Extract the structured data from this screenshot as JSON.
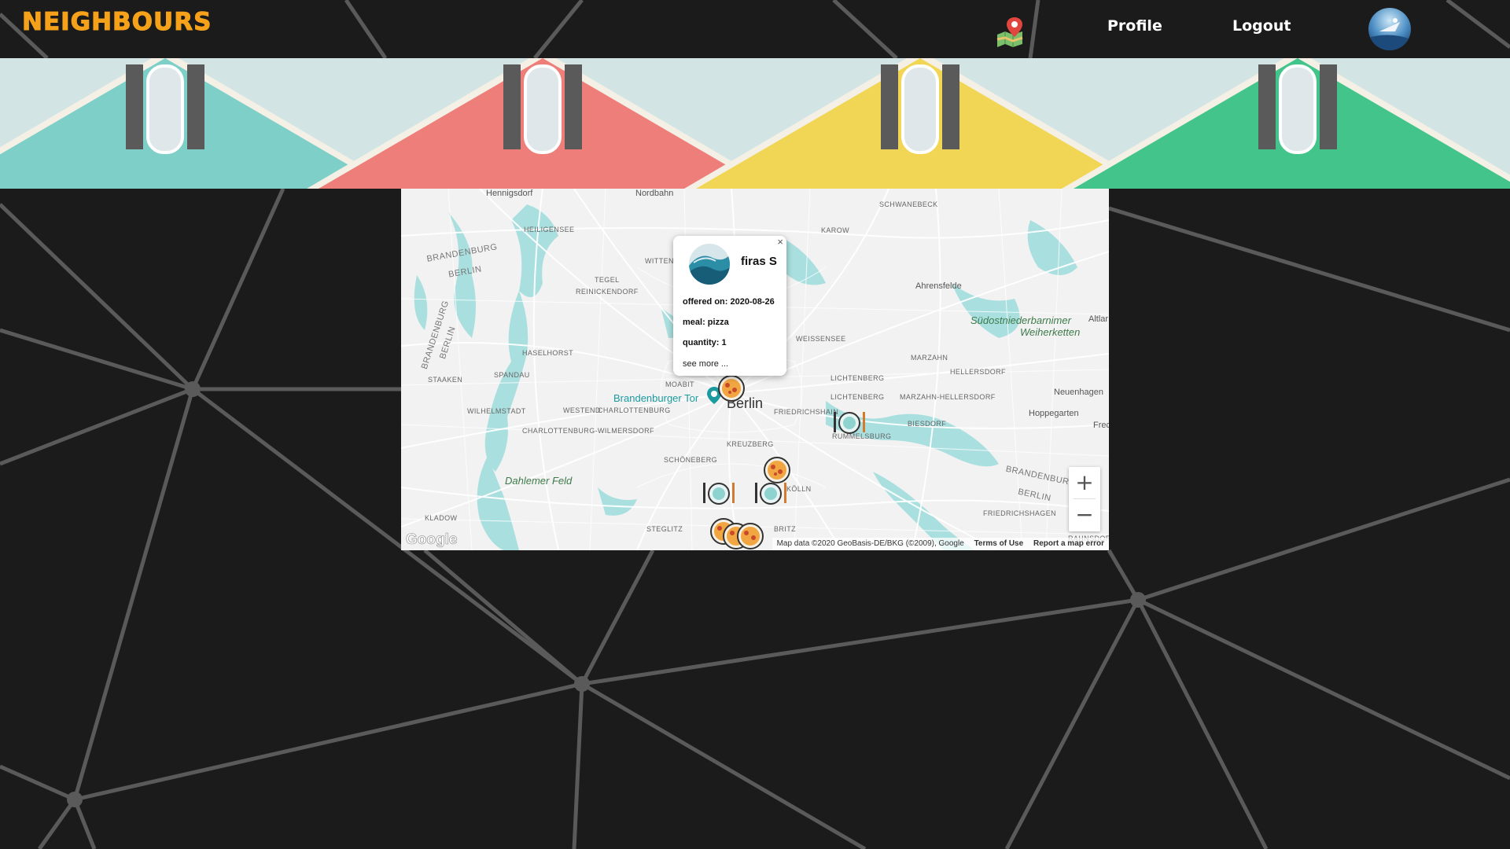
{
  "header": {
    "logo_text": "NEIGHBOURS",
    "map_icon": "map-pin-icon",
    "nav": {
      "profile": "Profile",
      "logout": "Logout"
    },
    "avatar_icon": "user-avatar"
  },
  "banner": {
    "houses": [
      {
        "color": "#7fcfc9"
      },
      {
        "color": "#ee7e7a"
      },
      {
        "color": "#f1d655"
      },
      {
        "color": "#43c48a"
      }
    ]
  },
  "map": {
    "labels": {
      "hennigsdorf": "Hennigsdorf",
      "nordbahn": "Nordbahn",
      "schwanebeck": "SCHWANEBECK",
      "heiligensee": "HEILIGENSEE",
      "karow": "KAROW",
      "brandenburg_nw": "BRANDENBURG",
      "berlin_nw": "BERLIN",
      "witten": "WITTEN",
      "tegel": "TEGEL",
      "reinickendorf": "REINICKENDORF",
      "ahrensfelde": "Ahrensfelde",
      "suedost1": "Südostniederbarnimer",
      "suedost2": "Weiherketten",
      "altlan": "Altlar",
      "brandenburg_w": "BRANDENBURG",
      "berlin_w": "BERLIN",
      "weissensee": "WEISSENSEE",
      "haselhorst": "HASELHORST",
      "marzahn": "MARZAHN",
      "hellersdorf": "HELLERSDORF",
      "spandau": "SPANDAU",
      "staaken": "STAAKEN",
      "lichtenberg1": "LICHTENBERG",
      "moabit": "MOABIT",
      "lichtenberg2": "LICHTENBERG",
      "marzahn_hellersdorf": "MARZAHN-HELLERSDORF",
      "neuenhagen": "Neuenhagen",
      "brandenburger_tor": "Brandenburger Tor",
      "berlin_city": "Berlin",
      "wilhelmstadt": "WILHELMSTADT",
      "westend": "WESTEND",
      "charlottenburg": "CHARLOTTENBURG",
      "friedrichshain": "FRIEDRICHSHAIN",
      "hoppegarten": "Hoppegarten",
      "biesdorf": "BIESDORF",
      "fred": "Fred",
      "charlottenburg_wilmersdorf": "CHARLOTTENBURG-WILMERSDORF",
      "rummelsburg": "RUMMELSBURG",
      "kreuzberg": "KREUZBERG",
      "schoeneberg": "SCHÖNEBERG",
      "dahlemer_feld": "Dahlemer Feld",
      "koelln": "KÖLLN",
      "brandenburg_se": "BRANDENBURG",
      "berlin_se": "BERLIN",
      "friedrichshagen": "FRIEDRICHSHAGEN",
      "kladow": "KLADOW",
      "steglitz": "STEGLITZ",
      "britz": "BRITZ",
      "rahnsdorf": "RAHNSDORF"
    },
    "popup": {
      "name": "firas S",
      "offered": "offered on: 2020-08-26",
      "meal": "meal: pizza",
      "quantity": "quantity: 1",
      "see_more": "see more ...",
      "close": "×"
    },
    "zoom": {
      "in": "+",
      "out": "−"
    },
    "attribution": {
      "data": "Map data ©2020 GeoBasis-DE/BKG (©2009), Google",
      "terms": "Terms of Use",
      "report": "Report a map error"
    },
    "google_logo": "Google",
    "colors": {
      "water": "#aadfdf",
      "land": "#f2f2f2",
      "roads": "#ffffff",
      "poi": "#1b9aa0"
    }
  }
}
